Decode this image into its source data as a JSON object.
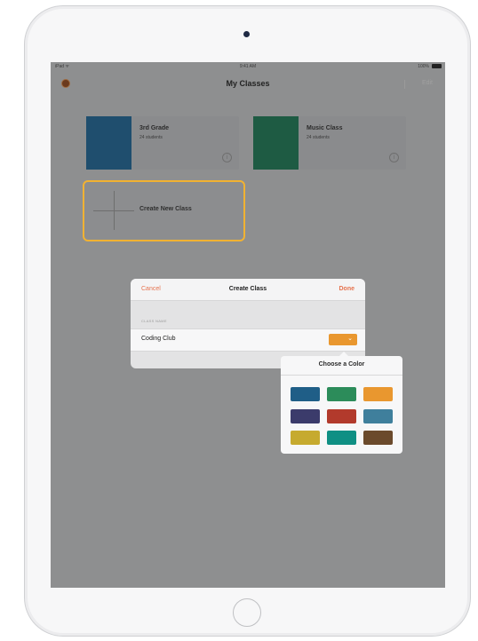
{
  "device": {
    "frame_color": "#f7f7f8",
    "camera": "camera-dot",
    "home_button": "home-button-circle"
  },
  "statusbar": {
    "left": "iPad ᯤ",
    "time": "9:41 AM",
    "right": "100%"
  },
  "navbar": {
    "title": "My Classes",
    "edit": "Edit"
  },
  "classes": [
    {
      "name": "3rd Grade",
      "count": "24 students",
      "color": "#1f4e6e",
      "icon": "info-icon"
    },
    {
      "name": "Music Class",
      "count": "24 students",
      "color": "#1e5b43",
      "icon": "info-icon"
    }
  ],
  "create_class_card": {
    "label": "Create New Class",
    "icon": "plus-icon",
    "highlight_color": "#f1b232"
  },
  "dialog": {
    "cancel": "Cancel",
    "title": "Create Class",
    "done": "Done",
    "section_label": "CLASS NAME",
    "name_value": "Coding Club",
    "selected_color": "#e9972f",
    "accent_color": "#e6734f"
  },
  "color_picker": {
    "title": "Choose a Color",
    "colors": [
      "#1f5e87",
      "#2c8c5a",
      "#e9972f",
      "#3b3b6b",
      "#b23a2c",
      "#3f7f9c",
      "#c6aa2f",
      "#0f8f84",
      "#6b4a2c"
    ]
  }
}
